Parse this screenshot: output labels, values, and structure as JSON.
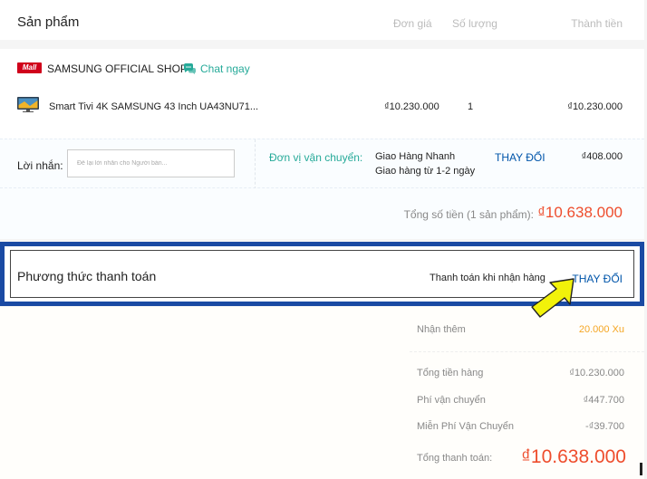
{
  "header": {
    "title": "Sản phẩm",
    "col_price": "Đơn giá",
    "col_qty": "Số lượng",
    "col_total": "Thành tiền"
  },
  "shop": {
    "badge": "Mall",
    "name": "SAMSUNG OFFICIAL SHOP",
    "chat_label": "Chat ngay",
    "product": {
      "name": "Smart Tivi 4K SAMSUNG 43 Inch UA43NU71...",
      "unit_price": "₫10.230.000",
      "quantity": "1",
      "total": "₫10.230.000"
    },
    "message": {
      "label": "Lời nhắn:",
      "placeholder": "Để lại lời nhắn cho Người bán..."
    },
    "shipping": {
      "label": "Đơn vị vận chuyển:",
      "carrier": "Giao Hàng Nhanh",
      "eta": "Giao hàng từ 1-2 ngày",
      "change_label": "THAY ĐỔI",
      "fee": "₫408.000"
    },
    "order_total": {
      "label": "Tổng số tiền (1 sản phẩm):",
      "value": "₫10.638.000"
    }
  },
  "payment": {
    "title": "Phương thức thanh toán",
    "method": "Thanh toán khi nhận hàng",
    "change_label": "THAY ĐỔI"
  },
  "summary": {
    "coins_label": "Nhận thêm",
    "coins_value": "20.000 Xu",
    "items_label": "Tổng tiền hàng",
    "items_value": "₫10.230.000",
    "shipping_label": "Phí vận chuyển",
    "shipping_value": "₫447.700",
    "free_ship_label": "Miễn Phí Vận Chuyển",
    "free_ship_value": "-₫39.700",
    "grand_label": "Tổng thanh toán:",
    "grand_value": "₫10.638.000"
  },
  "colors": {
    "accent_red": "#ee4d2d",
    "link_blue": "#0055aa",
    "teal": "#26aa99",
    "highlight_frame": "#1a4aa3",
    "arrow_yellow": "#f2f20a"
  }
}
